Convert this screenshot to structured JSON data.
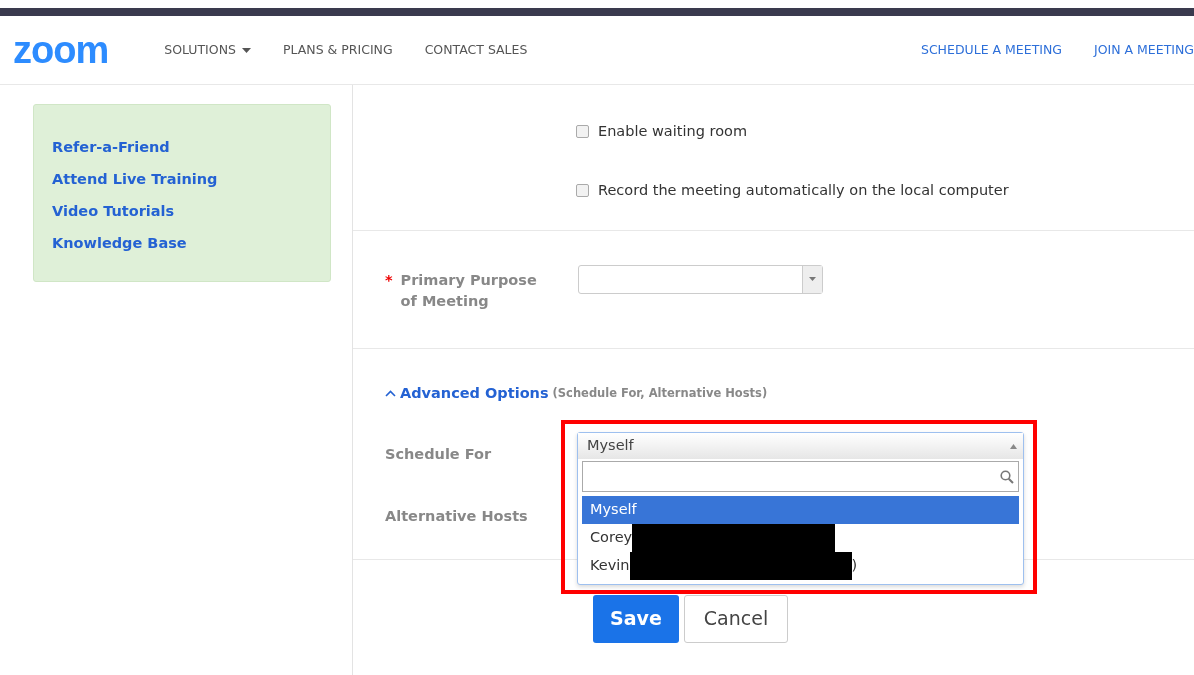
{
  "header": {
    "logo": "zoom",
    "nav": [
      {
        "label": "SOLUTIONS",
        "dropdown": true
      },
      {
        "label": "PLANS & PRICING",
        "dropdown": false
      },
      {
        "label": "CONTACT SALES",
        "dropdown": false
      }
    ],
    "actions": [
      "SCHEDULE A MEETING",
      "JOIN A MEETING"
    ]
  },
  "sidebar": {
    "links": [
      "Refer-a-Friend",
      "Attend Live Training",
      "Video Tutorials",
      "Knowledge Base"
    ]
  },
  "options": [
    {
      "label": "Enable waiting room",
      "checked": false
    },
    {
      "label": "Record the meeting automatically on the local computer",
      "checked": false
    }
  ],
  "purpose": {
    "label": "Primary Purpose of Meeting",
    "required": true,
    "required_mark": "*"
  },
  "advanced": {
    "title": "Advanced Options",
    "hint": "(Schedule For, Alternative Hosts)",
    "expanded": true
  },
  "schedule_for": {
    "label": "Schedule For",
    "value": "Myself",
    "open": true,
    "options": [
      {
        "label": "Myself",
        "selected": true,
        "redacted": false
      },
      {
        "label": "Corey",
        "selected": false,
        "redacted": true
      },
      {
        "label": "Kevin",
        "selected": false,
        "redacted": true,
        "suffix": ")"
      }
    ]
  },
  "alternative_hosts": {
    "label": "Alternative Hosts"
  },
  "buttons": [
    {
      "label": "Save",
      "kind": "primary"
    },
    {
      "label": "Cancel",
      "kind": "secondary"
    }
  ],
  "highlight": true
}
